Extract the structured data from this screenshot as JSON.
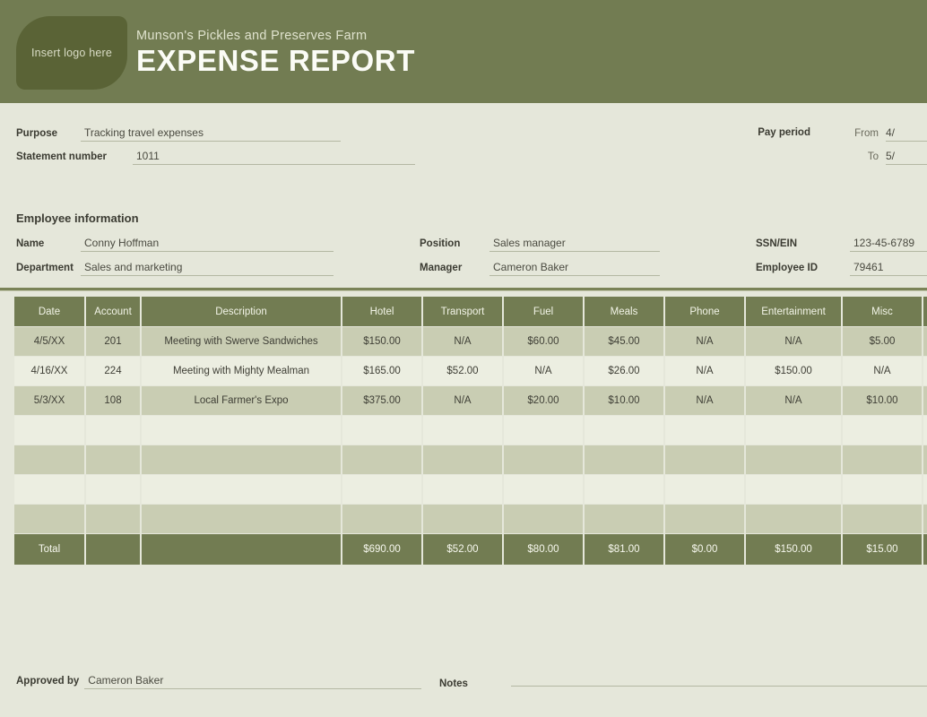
{
  "header": {
    "logo_placeholder": "Insert logo here",
    "company_name": "Munson's Pickles and Preserves Farm",
    "doc_title": "EXPENSE REPORT",
    "banner_color": "#727c52",
    "logo_color": "#5a6336"
  },
  "purpose": {
    "purpose_label": "Purpose",
    "purpose_value": "Tracking travel expenses",
    "statement_label": "Statement number",
    "statement_value": "1011"
  },
  "pay_period": {
    "label": "Pay period",
    "from_label": "From",
    "from_value": "4/",
    "to_label": "To",
    "to_value": "5/"
  },
  "employee": {
    "section_title": "Employee information",
    "name_label": "Name",
    "name_value": "Conny Hoffman",
    "department_label": "Department",
    "department_value": "Sales and marketing",
    "position_label": "Position",
    "position_value": "Sales manager",
    "manager_label": "Manager",
    "manager_value": "Cameron Baker",
    "ssn_label": "SSN/EIN",
    "ssn_value": "123-45-6789",
    "employee_id_label": "Employee ID",
    "employee_id_value": "79461"
  },
  "table": {
    "headers": [
      "Date",
      "Account",
      "Description",
      "Hotel",
      "Transport",
      "Fuel",
      "Meals",
      "Phone",
      "Entertainment",
      "Misc",
      ""
    ],
    "rows": [
      {
        "date": "4/5/XX",
        "account": "201",
        "description": "Meeting with Swerve Sandwiches",
        "hotel": "$150.00",
        "transport": "N/A",
        "fuel": "$60.00",
        "meals": "$45.00",
        "phone": "N/A",
        "entertainment": "N/A",
        "misc": "$5.00",
        "extra": ""
      },
      {
        "date": "4/16/XX",
        "account": "224",
        "description": "Meeting with Mighty Mealman",
        "hotel": "$165.00",
        "transport": "$52.00",
        "fuel": "N/A",
        "meals": "$26.00",
        "phone": "N/A",
        "entertainment": "$150.00",
        "misc": "N/A",
        "extra": ""
      },
      {
        "date": "5/3/XX",
        "account": "108",
        "description": "Local Farmer's Expo",
        "hotel": "$375.00",
        "transport": "N/A",
        "fuel": "$20.00",
        "meals": "$10.00",
        "phone": "N/A",
        "entertainment": "N/A",
        "misc": "$10.00",
        "extra": ""
      },
      {
        "date": "",
        "account": "",
        "description": "",
        "hotel": "",
        "transport": "",
        "fuel": "",
        "meals": "",
        "phone": "",
        "entertainment": "",
        "misc": "",
        "extra": ""
      },
      {
        "date": "",
        "account": "",
        "description": "",
        "hotel": "",
        "transport": "",
        "fuel": "",
        "meals": "",
        "phone": "",
        "entertainment": "",
        "misc": "",
        "extra": ""
      },
      {
        "date": "",
        "account": "",
        "description": "",
        "hotel": "",
        "transport": "",
        "fuel": "",
        "meals": "",
        "phone": "",
        "entertainment": "",
        "misc": "",
        "extra": ""
      },
      {
        "date": "",
        "account": "",
        "description": "",
        "hotel": "",
        "transport": "",
        "fuel": "",
        "meals": "",
        "phone": "",
        "entertainment": "",
        "misc": "",
        "extra": ""
      }
    ],
    "total": {
      "label": "Total",
      "account": "",
      "description": "",
      "hotel": "$690.00",
      "transport": "$52.00",
      "fuel": "$80.00",
      "meals": "$81.00",
      "phone": "$0.00",
      "entertainment": "$150.00",
      "misc": "$15.00",
      "extra": ""
    }
  },
  "footer": {
    "approved_label": "Approved by",
    "approved_value": "Cameron Baker",
    "notes_label": "Notes",
    "notes_value": ""
  }
}
